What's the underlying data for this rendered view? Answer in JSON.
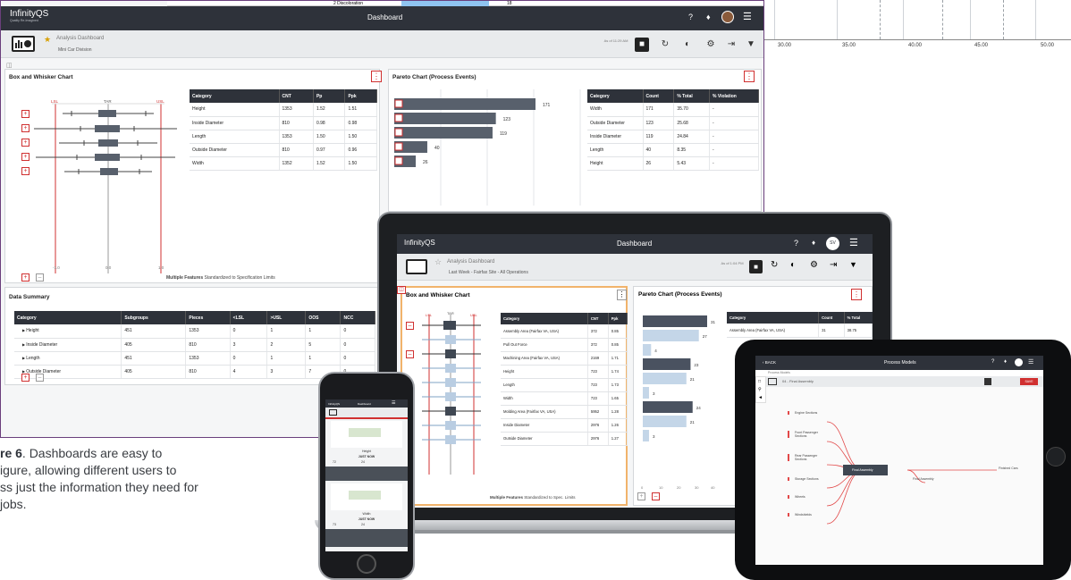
{
  "bg_chart": {
    "ticks": [
      "30.00",
      "35.00",
      "40.00",
      "45.00",
      "50.00"
    ]
  },
  "top_strip": {
    "row_label": "2 Discoloration",
    "row_value": "18"
  },
  "dashboard": {
    "logo": "InfinityQS",
    "logo_sub": "Quality Re-Imagined",
    "title": "Dashboard",
    "help": "?",
    "toolbar": {
      "analysis_label": "Analysis Dashboard",
      "division": "Mini Car Division",
      "as_of": "As of 11:29 AM"
    },
    "box_panel": {
      "title": "Box and Whisker Chart",
      "limits": [
        "LSL",
        "TAR",
        "USL"
      ],
      "xticks": [
        "-1.0",
        "0.0",
        "1.0"
      ],
      "footer_bold": "Multiple Features",
      "footer_rest": "Standardized to Specification Limits",
      "headers": [
        "Category",
        "CNT",
        "Pp",
        "Ppk"
      ],
      "rows": [
        [
          "Height",
          "1353",
          "1.52",
          "1.51"
        ],
        [
          "Inside Diameter",
          "810",
          "0.98",
          "0.98"
        ],
        [
          "Length",
          "1353",
          "1.50",
          "1.50"
        ],
        [
          "Outside Diameter",
          "810",
          "0.97",
          "0.96"
        ],
        [
          "Width",
          "1352",
          "1.52",
          "1.50"
        ]
      ]
    },
    "pareto_panel": {
      "title": "Pareto Chart (Process Events)",
      "bar_values": [
        171,
        123,
        119,
        40,
        26
      ],
      "headers": [
        "Category",
        "Count",
        "% Total",
        "% Violation"
      ],
      "rows": [
        [
          "Width",
          "171",
          "35.70",
          "-"
        ],
        [
          "Outside Diameter",
          "123",
          "25.68",
          "-"
        ],
        [
          "Inside Diameter",
          "119",
          "24.84",
          "-"
        ],
        [
          "Length",
          "40",
          "8.35",
          "-"
        ],
        [
          "Height",
          "26",
          "5.43",
          "-"
        ]
      ]
    },
    "summary_panel": {
      "title": "Data Summary",
      "headers": [
        "Category",
        "Subgroups",
        "Pieces",
        "<LSL",
        ">USL",
        "OOS",
        "NCC"
      ],
      "rows": [
        [
          "Height",
          "451",
          "1353",
          "0",
          "1",
          "1",
          "0"
        ],
        [
          "Inside Diameter",
          "405",
          "810",
          "3",
          "2",
          "5",
          "0"
        ],
        [
          "Length",
          "451",
          "1353",
          "0",
          "1",
          "1",
          "0"
        ],
        [
          "Outside Diameter",
          "405",
          "810",
          "4",
          "3",
          "7",
          "0"
        ]
      ]
    }
  },
  "caption": {
    "bold": "re 6",
    "rest": ". Dashboards are easy to",
    "line2": "igure, allowing different users to",
    "line3": "ss just the information they need for",
    "line4": "jobs."
  },
  "laptop": {
    "logo": "InfinityQS",
    "title": "Dashboard",
    "avatar": "SV",
    "analysis_label": "Analysis Dashboard",
    "filter": "Last Week - Fairfax Site - All Operations",
    "as_of": "As of 1:04 PM",
    "box_title": "Box and Whisker Chart",
    "pareto_title": "Pareto Chart (Process Events)",
    "limits": [
      "LSL",
      "TAR",
      "USL"
    ],
    "footer_bold": "Multiple Features",
    "footer_rest": "Standardized to Spec. Limits",
    "box_headers": [
      "Category",
      "CNT",
      "Ppk"
    ],
    "box_rows": [
      [
        "Assembly Area (Fairfax VA, USA)",
        "372",
        "0.85"
      ],
      [
        "Pull Out Force",
        "372",
        "0.85"
      ],
      [
        "Machining Area (Fairfax VA, USA)",
        "2169",
        "1.71"
      ],
      [
        "Height",
        "723",
        "1.74"
      ],
      [
        "Length",
        "723",
        "1.73"
      ],
      [
        "Width",
        "723",
        "1.65"
      ],
      [
        "Molding Area (Fairfax VA, USA)",
        "5952",
        "1.28"
      ],
      [
        "Inside Diameter",
        "2976",
        "1.26"
      ],
      [
        "Outside Diameter",
        "2976",
        "1.27"
      ]
    ],
    "pareto_headers": [
      "Category",
      "Count",
      "% Total"
    ],
    "pareto_first": [
      "Assembly Area (Fairfax VA, USA)",
      "31",
      "38.75"
    ],
    "pareto_vals": [
      "31",
      "27",
      "4",
      "23",
      "21",
      "3",
      "24",
      "21",
      "3"
    ],
    "pareto_xticks": [
      "0",
      "10",
      "20",
      "30",
      "40"
    ]
  },
  "tablet": {
    "back": "BACK",
    "title": "Process Models",
    "crumb": "Process Models",
    "model": "04 - Final Assembly",
    "save": "SAVE",
    "nodes": [
      "Engine Sections",
      "Front Passenger Sections",
      "Rear Passenger Sections",
      "Storage Sections",
      "Wheels",
      "Windshields"
    ],
    "center": "Final Assembly",
    "small": "Final Assembly",
    "out": "Finished Cars"
  },
  "phone": {
    "logo": "InfinityQS",
    "title": "Dashboard",
    "card1_label": "Height",
    "card1_time": "JUST NOW",
    "card1_a": "72",
    "card1_b": "24",
    "card2_label": "Width",
    "card2_time": "JUST NOW",
    "card2_a": "73",
    "card2_b": "24"
  }
}
